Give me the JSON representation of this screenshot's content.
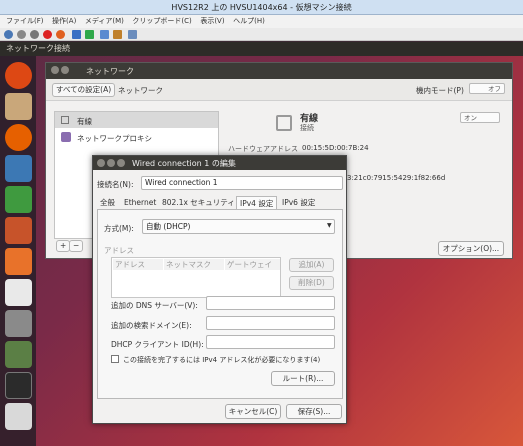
{
  "window": {
    "title": "HVS12R2 上の HVSU1404x64 - 仮想マシン接続",
    "menu": [
      "ファイル(F)",
      "操作(A)",
      "メディア(M)",
      "クリップボード(C)",
      "表示(V)",
      "ヘルプ(H)"
    ]
  },
  "ubuntu": {
    "top_title": "ネットワーク接続"
  },
  "network": {
    "title": "ネットワーク",
    "all_settings": "すべての設定(A)",
    "crumb": "ネットワーク",
    "airplane_label": "機内モード(P)",
    "airplane_state": "オフ",
    "list": [
      {
        "label": "有線"
      },
      {
        "label": "ネットワークプロキシ"
      }
    ],
    "add": "+",
    "remove": "−",
    "wired_title": "有線",
    "wired_status": "接続",
    "wired_toggle": "オン",
    "hw_label": "ハードウェアアドレス",
    "hw_value": "00:15:5D:00:7B:24",
    "ipv6_partial": "3:21c0:7915:5429:1f82:66d",
    "options_button": "オプション(O)..."
  },
  "dialog": {
    "title": "Wired connection 1 の編集",
    "conn_name_label": "接続名(N):",
    "conn_name_value": "Wired connection 1",
    "tabs": [
      "全般",
      "Ethernet",
      "802.1x セキュリティ",
      "IPv4 設定",
      "IPv6 設定"
    ],
    "active_tab": "IPv4 設定",
    "method_label": "方式(M):",
    "method_value": "自動 (DHCP)",
    "address_section": "アドレス",
    "table_headers": [
      "アドレス",
      "ネットマスク",
      "ゲートウェイ"
    ],
    "add_button": "追加(A)",
    "delete_button": "削除(D)",
    "dns_label": "追加の DNS サーバー(V):",
    "search_label": "追加の検索ドメイン(E):",
    "dhcp_label": "DHCP クライアント ID(H):",
    "require_label": "この接続を完了するには IPv4 アドレス化が必要になります(4)",
    "routes_button": "ルート(R)...",
    "cancel_button": "キャンセル(C)",
    "save_button": "保存(S)..."
  },
  "colors": {
    "ubuntu_orange": "#dd4814",
    "titlebar": "#3c3b37",
    "launcher": "#2b2530"
  }
}
